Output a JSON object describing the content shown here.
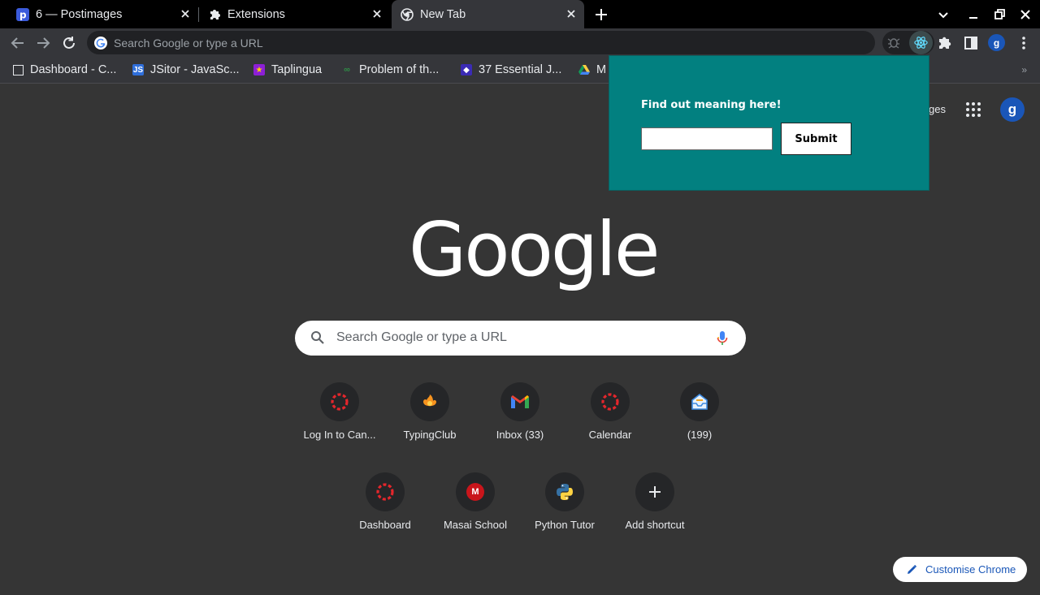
{
  "tabs": [
    {
      "title": "6 — Postimages",
      "icon": "postimages-icon"
    },
    {
      "title": "Extensions",
      "icon": "puzzle-icon"
    },
    {
      "title": "New Tab",
      "icon": "chrome-icon",
      "active": true
    }
  ],
  "toolbar": {
    "omnibox_placeholder": "Search Google or type a URL",
    "profile_initial": "g"
  },
  "bookmarks": [
    {
      "title": "Dashboard - C...",
      "icon": "page-icon"
    },
    {
      "title": "JSitor - JavaSc...",
      "icon": "jsitor-icon"
    },
    {
      "title": "Taplingua",
      "icon": "taplingua-icon"
    },
    {
      "title": "Problem of th...",
      "icon": "gfg-icon"
    },
    {
      "title": "37 Essential J...",
      "icon": "toptal-icon"
    },
    {
      "title": "M",
      "icon": "drive-icon"
    }
  ],
  "ntp": {
    "images_link": "ges",
    "avatar_initial": "g",
    "search_placeholder": "Search Google or type a URL",
    "logo_text": "Google",
    "customise_label": "Customise Chrome"
  },
  "popup": {
    "title": "Find out meaning here!",
    "input_value": "",
    "submit_label": "Submit",
    "background": "#028080"
  },
  "shortcuts_row1": [
    {
      "label": "Log In to Can...",
      "icon": "canvas-icon"
    },
    {
      "label": "TypingClub",
      "icon": "typingclub-icon"
    },
    {
      "label": "Inbox (33)",
      "icon": "gmail-icon"
    },
    {
      "label": "Calendar",
      "icon": "canvas-icon"
    },
    {
      "label": "(199)",
      "icon": "inbox-tray-icon"
    }
  ],
  "shortcuts_row2": [
    {
      "label": "Dashboard",
      "icon": "canvas-icon"
    },
    {
      "label": "Masai School",
      "icon": "masai-icon",
      "letter": "M"
    },
    {
      "label": "Python Tutor",
      "icon": "python-icon"
    },
    {
      "label": "Add shortcut",
      "icon": "plus-icon"
    }
  ]
}
